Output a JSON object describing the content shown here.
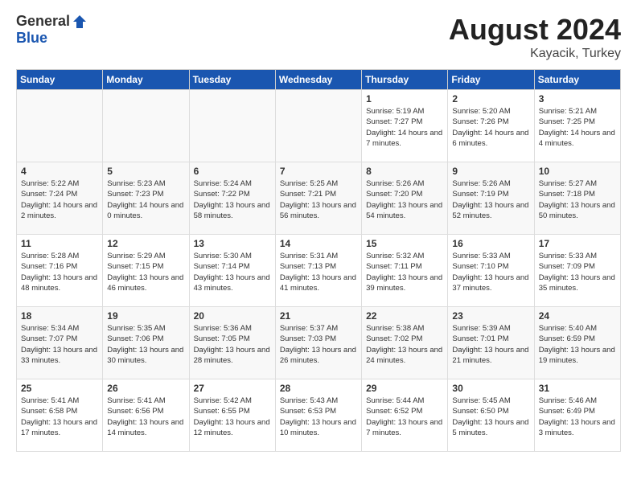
{
  "header": {
    "logo_general": "General",
    "logo_blue": "Blue",
    "month_year": "August 2024",
    "location": "Kayacik, Turkey"
  },
  "days_of_week": [
    "Sunday",
    "Monday",
    "Tuesday",
    "Wednesday",
    "Thursday",
    "Friday",
    "Saturday"
  ],
  "weeks": [
    [
      {
        "day": "",
        "empty": true
      },
      {
        "day": "",
        "empty": true
      },
      {
        "day": "",
        "empty": true
      },
      {
        "day": "",
        "empty": true
      },
      {
        "day": "1",
        "sunrise": "5:19 AM",
        "sunset": "7:27 PM",
        "daylight": "Daylight: 14 hours and 7 minutes."
      },
      {
        "day": "2",
        "sunrise": "5:20 AM",
        "sunset": "7:26 PM",
        "daylight": "Daylight: 14 hours and 6 minutes."
      },
      {
        "day": "3",
        "sunrise": "5:21 AM",
        "sunset": "7:25 PM",
        "daylight": "Daylight: 14 hours and 4 minutes."
      }
    ],
    [
      {
        "day": "4",
        "sunrise": "5:22 AM",
        "sunset": "7:24 PM",
        "daylight": "Daylight: 14 hours and 2 minutes."
      },
      {
        "day": "5",
        "sunrise": "5:23 AM",
        "sunset": "7:23 PM",
        "daylight": "Daylight: 14 hours and 0 minutes."
      },
      {
        "day": "6",
        "sunrise": "5:24 AM",
        "sunset": "7:22 PM",
        "daylight": "Daylight: 13 hours and 58 minutes."
      },
      {
        "day": "7",
        "sunrise": "5:25 AM",
        "sunset": "7:21 PM",
        "daylight": "Daylight: 13 hours and 56 minutes."
      },
      {
        "day": "8",
        "sunrise": "5:26 AM",
        "sunset": "7:20 PM",
        "daylight": "Daylight: 13 hours and 54 minutes."
      },
      {
        "day": "9",
        "sunrise": "5:26 AM",
        "sunset": "7:19 PM",
        "daylight": "Daylight: 13 hours and 52 minutes."
      },
      {
        "day": "10",
        "sunrise": "5:27 AM",
        "sunset": "7:18 PM",
        "daylight": "Daylight: 13 hours and 50 minutes."
      }
    ],
    [
      {
        "day": "11",
        "sunrise": "5:28 AM",
        "sunset": "7:16 PM",
        "daylight": "Daylight: 13 hours and 48 minutes."
      },
      {
        "day": "12",
        "sunrise": "5:29 AM",
        "sunset": "7:15 PM",
        "daylight": "Daylight: 13 hours and 46 minutes."
      },
      {
        "day": "13",
        "sunrise": "5:30 AM",
        "sunset": "7:14 PM",
        "daylight": "Daylight: 13 hours and 43 minutes."
      },
      {
        "day": "14",
        "sunrise": "5:31 AM",
        "sunset": "7:13 PM",
        "daylight": "Daylight: 13 hours and 41 minutes."
      },
      {
        "day": "15",
        "sunrise": "5:32 AM",
        "sunset": "7:11 PM",
        "daylight": "Daylight: 13 hours and 39 minutes."
      },
      {
        "day": "16",
        "sunrise": "5:33 AM",
        "sunset": "7:10 PM",
        "daylight": "Daylight: 13 hours and 37 minutes."
      },
      {
        "day": "17",
        "sunrise": "5:33 AM",
        "sunset": "7:09 PM",
        "daylight": "Daylight: 13 hours and 35 minutes."
      }
    ],
    [
      {
        "day": "18",
        "sunrise": "5:34 AM",
        "sunset": "7:07 PM",
        "daylight": "Daylight: 13 hours and 33 minutes."
      },
      {
        "day": "19",
        "sunrise": "5:35 AM",
        "sunset": "7:06 PM",
        "daylight": "Daylight: 13 hours and 30 minutes."
      },
      {
        "day": "20",
        "sunrise": "5:36 AM",
        "sunset": "7:05 PM",
        "daylight": "Daylight: 13 hours and 28 minutes."
      },
      {
        "day": "21",
        "sunrise": "5:37 AM",
        "sunset": "7:03 PM",
        "daylight": "Daylight: 13 hours and 26 minutes."
      },
      {
        "day": "22",
        "sunrise": "5:38 AM",
        "sunset": "7:02 PM",
        "daylight": "Daylight: 13 hours and 24 minutes."
      },
      {
        "day": "23",
        "sunrise": "5:39 AM",
        "sunset": "7:01 PM",
        "daylight": "Daylight: 13 hours and 21 minutes."
      },
      {
        "day": "24",
        "sunrise": "5:40 AM",
        "sunset": "6:59 PM",
        "daylight": "Daylight: 13 hours and 19 minutes."
      }
    ],
    [
      {
        "day": "25",
        "sunrise": "5:41 AM",
        "sunset": "6:58 PM",
        "daylight": "Daylight: 13 hours and 17 minutes."
      },
      {
        "day": "26",
        "sunrise": "5:41 AM",
        "sunset": "6:56 PM",
        "daylight": "Daylight: 13 hours and 14 minutes."
      },
      {
        "day": "27",
        "sunrise": "5:42 AM",
        "sunset": "6:55 PM",
        "daylight": "Daylight: 13 hours and 12 minutes."
      },
      {
        "day": "28",
        "sunrise": "5:43 AM",
        "sunset": "6:53 PM",
        "daylight": "Daylight: 13 hours and 10 minutes."
      },
      {
        "day": "29",
        "sunrise": "5:44 AM",
        "sunset": "6:52 PM",
        "daylight": "Daylight: 13 hours and 7 minutes."
      },
      {
        "day": "30",
        "sunrise": "5:45 AM",
        "sunset": "6:50 PM",
        "daylight": "Daylight: 13 hours and 5 minutes."
      },
      {
        "day": "31",
        "sunrise": "5:46 AM",
        "sunset": "6:49 PM",
        "daylight": "Daylight: 13 hours and 3 minutes."
      }
    ]
  ]
}
